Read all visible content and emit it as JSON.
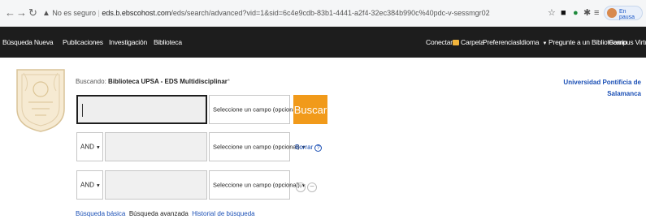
{
  "browser": {
    "back_icon": "back-arrow-icon",
    "forward_icon": "forward-arrow-icon",
    "reload_icon": "reload-icon",
    "insecure_label": "No es seguro",
    "host": "eds.b.ebscohost.com",
    "path": "/eds/search/advanced?vid=1&sid=6c4e9cdb-83b1-4441-a2f4-32ec384b990c%40pdc-v-sessmgr02",
    "paused_label": "En pausa"
  },
  "nav": {
    "left": [
      "Búsqueda Nueva",
      "Publicaciones",
      "Investigación",
      "Biblioteca"
    ],
    "connect": "Conectar",
    "folder": "Carpeta",
    "preferences": "Preferencias",
    "language": "Idioma",
    "ask": "Pregunte a un Bibliotecario",
    "virtual": "Campus Virtual"
  },
  "search": {
    "searching_prefix": "Buscando:",
    "database": "Biblioteca UPSA - EDS Multidisciplinar",
    "field_placeholder": "Seleccione un campo (opcional)",
    "operator": "AND",
    "search_button": "Buscar",
    "clear_link": "Borrar",
    "help_glyph": "?"
  },
  "institution": "Universidad Pontificia de Salamanca",
  "links": {
    "basic": "Búsqueda básica",
    "advanced": "Búsqueda avanzada",
    "history": "Historial de búsqueda"
  },
  "colors": {
    "nav_bg": "#1d1d1d",
    "search_button": "#f19a1a",
    "link": "#1a4fb5"
  }
}
